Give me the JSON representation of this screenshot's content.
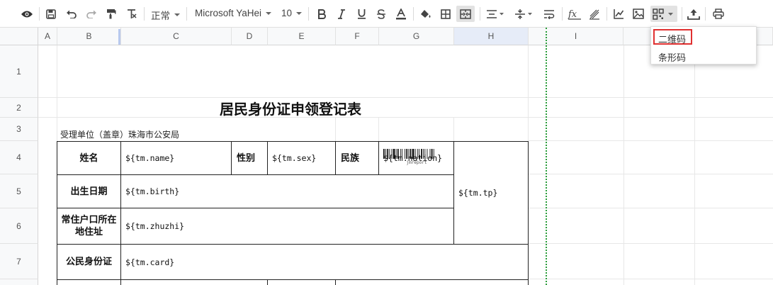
{
  "toolbar": {
    "icons": [
      "preview-icon",
      "save-icon",
      "undo-icon",
      "redo-icon",
      "format-painter-icon",
      "clear-format-icon",
      "bold-icon",
      "italic-icon",
      "underline-icon",
      "strikethrough-icon",
      "font-color-icon",
      "fill-color-icon",
      "border-icon",
      "merge-cells-icon",
      "align-icon",
      "valign-icon",
      "text-wrap-icon",
      "formula-icon",
      "slash-icon",
      "chart-icon",
      "image-icon",
      "qrcode-icon",
      "upload-icon",
      "print-icon"
    ],
    "format_label": "正常",
    "font_family": "Microsoft YaHei",
    "font_size": "10"
  },
  "dropdown": {
    "items": [
      "二维码",
      "条形码"
    ],
    "highlighted": "二维码",
    "highlight_color": "#e03030"
  },
  "columns": [
    "A",
    "B",
    "C",
    "D",
    "E",
    "F",
    "G",
    "H",
    "I"
  ],
  "rows": [
    "1",
    "2",
    "3",
    "4",
    "5",
    "6",
    "7"
  ],
  "sheet": {
    "title": "居民身份证申领登记表",
    "issuer": "受理单位（盖章）珠海市公安局",
    "barcode_caption": "jmreport",
    "labels": {
      "name": "姓名",
      "sex": "性别",
      "nation": "民族",
      "birth": "出生日期",
      "address": "常住户口所在地住址",
      "card": "公民身份证"
    },
    "fields": {
      "name": "${tm.name}",
      "sex": "${tm.sex}",
      "nation": "${tm.nation}",
      "birth": "${tm.birth}",
      "zhuzhi": "${tm.zhuzhi}",
      "card": "${tm.card}",
      "tp": "${tm.tp}"
    }
  },
  "colors": {
    "page_break": "#2a9d3a",
    "selected_column_header": "#e6ecf8"
  }
}
